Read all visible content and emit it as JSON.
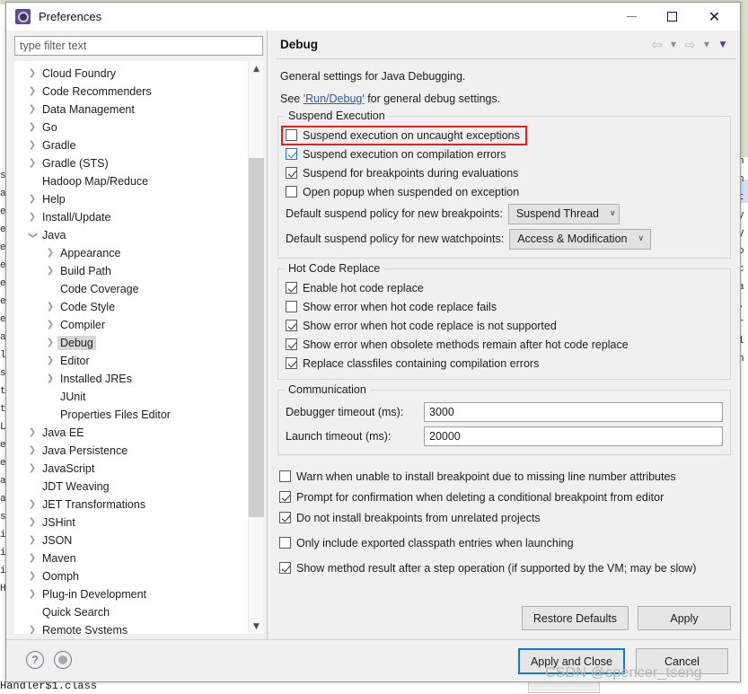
{
  "window": {
    "title": "Preferences",
    "icon": "eclipse-gear-icon",
    "minimize_label": "—",
    "maximize_label": "☐",
    "close_label": "✕"
  },
  "filter": {
    "placeholder": "type filter text",
    "value": ""
  },
  "tree": {
    "items": [
      {
        "label": "Cloud Foundry",
        "level": 0,
        "arrow": "collapsed",
        "selected": false
      },
      {
        "label": "Code Recommenders",
        "level": 0,
        "arrow": "collapsed",
        "selected": false
      },
      {
        "label": "Data Management",
        "level": 0,
        "arrow": "collapsed",
        "selected": false
      },
      {
        "label": "Go",
        "level": 0,
        "arrow": "collapsed",
        "selected": false
      },
      {
        "label": "Gradle",
        "level": 0,
        "arrow": "collapsed",
        "selected": false
      },
      {
        "label": "Gradle (STS)",
        "level": 0,
        "arrow": "collapsed",
        "selected": false
      },
      {
        "label": "Hadoop Map/Reduce",
        "level": 0,
        "arrow": "none",
        "selected": false
      },
      {
        "label": "Help",
        "level": 0,
        "arrow": "collapsed",
        "selected": false
      },
      {
        "label": "Install/Update",
        "level": 0,
        "arrow": "collapsed",
        "selected": false
      },
      {
        "label": "Java",
        "level": 0,
        "arrow": "expanded",
        "selected": false
      },
      {
        "label": "Appearance",
        "level": 1,
        "arrow": "collapsed",
        "selected": false
      },
      {
        "label": "Build Path",
        "level": 1,
        "arrow": "collapsed",
        "selected": false
      },
      {
        "label": "Code Coverage",
        "level": 1,
        "arrow": "none",
        "selected": false
      },
      {
        "label": "Code Style",
        "level": 1,
        "arrow": "collapsed",
        "selected": false
      },
      {
        "label": "Compiler",
        "level": 1,
        "arrow": "collapsed",
        "selected": false
      },
      {
        "label": "Debug",
        "level": 1,
        "arrow": "collapsed",
        "selected": true
      },
      {
        "label": "Editor",
        "level": 1,
        "arrow": "collapsed",
        "selected": false
      },
      {
        "label": "Installed JREs",
        "level": 1,
        "arrow": "collapsed",
        "selected": false
      },
      {
        "label": "JUnit",
        "level": 1,
        "arrow": "none",
        "selected": false
      },
      {
        "label": "Properties Files Editor",
        "level": 1,
        "arrow": "none",
        "selected": false
      },
      {
        "label": "Java EE",
        "level": 0,
        "arrow": "collapsed",
        "selected": false
      },
      {
        "label": "Java Persistence",
        "level": 0,
        "arrow": "collapsed",
        "selected": false
      },
      {
        "label": "JavaScript",
        "level": 0,
        "arrow": "collapsed",
        "selected": false
      },
      {
        "label": "JDT Weaving",
        "level": 0,
        "arrow": "none",
        "selected": false
      },
      {
        "label": "JET Transformations",
        "level": 0,
        "arrow": "collapsed",
        "selected": false
      },
      {
        "label": "JSHint",
        "level": 0,
        "arrow": "collapsed",
        "selected": false
      },
      {
        "label": "JSON",
        "level": 0,
        "arrow": "collapsed",
        "selected": false
      },
      {
        "label": "Maven",
        "level": 0,
        "arrow": "collapsed",
        "selected": false
      },
      {
        "label": "Oomph",
        "level": 0,
        "arrow": "collapsed",
        "selected": false
      },
      {
        "label": "Plug-in Development",
        "level": 0,
        "arrow": "collapsed",
        "selected": false
      },
      {
        "label": "Quick Search",
        "level": 0,
        "arrow": "none",
        "selected": false
      },
      {
        "label": "Remote Systems",
        "level": 0,
        "arrow": "collapsed",
        "selected": false
      }
    ]
  },
  "page": {
    "title": "Debug",
    "nav": {
      "back_icon": "arrow-left-icon",
      "back_caret_icon": "chevron-down-icon",
      "forward_icon": "arrow-right-icon",
      "forward_caret_icon": "chevron-down-icon",
      "menu_caret_icon": "chevron-down-filled-icon"
    },
    "description": "General settings for Java Debugging.",
    "see_prefix": "See ",
    "see_link": "'Run/Debug'",
    "see_suffix": " for general debug settings.",
    "groups": {
      "suspend": {
        "title": "Suspend Execution",
        "checkboxes": [
          {
            "label": "Suspend execution on uncaught exceptions",
            "checked": false,
            "highlighted": true,
            "blue": false
          },
          {
            "label": "Suspend execution on compilation errors",
            "checked": true,
            "highlighted": false,
            "blue": true
          },
          {
            "label": "Suspend for breakpoints during evaluations",
            "checked": true,
            "highlighted": false,
            "blue": false
          },
          {
            "label": "Open popup when suspended on exception",
            "checked": false,
            "highlighted": false,
            "blue": false
          }
        ],
        "policies": [
          {
            "label": "Default suspend policy for new breakpoints:",
            "value": "Suspend Thread",
            "width": "w1"
          },
          {
            "label": "Default suspend policy for new watchpoints:",
            "value": "Access & Modification",
            "width": "w2"
          }
        ]
      },
      "hotcode": {
        "title": "Hot Code Replace",
        "checkboxes": [
          {
            "label": "Enable hot code replace",
            "checked": true
          },
          {
            "label": "Show error when hot code replace fails",
            "checked": false
          },
          {
            "label": "Show error when hot code replace is not supported",
            "checked": true
          },
          {
            "label": "Show error when obsolete methods remain after hot code replace",
            "checked": true
          },
          {
            "label": "Replace classfiles containing compilation errors",
            "checked": true
          }
        ]
      },
      "communication": {
        "title": "Communication",
        "fields": [
          {
            "label": "Debugger timeout (ms):",
            "value": "3000"
          },
          {
            "label": "Launch timeout (ms):",
            "value": "20000"
          }
        ]
      }
    },
    "bottom_checkboxes": [
      {
        "label": "Warn when unable to install breakpoint due to missing line number attributes",
        "checked": false,
        "gap": false
      },
      {
        "label": "Prompt for confirmation when deleting a conditional breakpoint from editor",
        "checked": true,
        "gap": false
      },
      {
        "label": "Do not install breakpoints from unrelated projects",
        "checked": true,
        "gap": false
      },
      {
        "label": "Only include exported classpath entries when launching",
        "checked": false,
        "gap": true
      },
      {
        "label": "Show method result after a step operation (if supported by the VM; may be slow)",
        "checked": true,
        "gap": true
      }
    ],
    "buttons": {
      "restore_defaults": "Restore Defaults",
      "apply": "Apply"
    }
  },
  "footer": {
    "help_icon": "question-mark-icon",
    "status_icon": "record-circle-icon",
    "apply_and_close": "Apply and Close",
    "cancel": "Cancel"
  },
  "watermark": "CSDN @spencer_tseng",
  "background": {
    "left_fragments": [
      "ss",
      "as",
      "es",
      "es",
      "es",
      "es",
      "es",
      "es",
      "es",
      "ali",
      "li",
      "s",
      "to",
      "",
      "to",
      "Li",
      "",
      "eT",
      "eT",
      "as",
      "as",
      "ss",
      "",
      "iz",
      "iz",
      "iz",
      "H"
    ],
    "right_fragments": [
      "",
      "",
      "",
      "",
      "",
      "",
      "",
      "h",
      "h",
      "t",
      "y",
      "y",
      "o",
      "c",
      "a",
      ".",
      "r",
      "l",
      "",
      "h"
    ],
    "bottom_text": "Handler$1.class"
  }
}
